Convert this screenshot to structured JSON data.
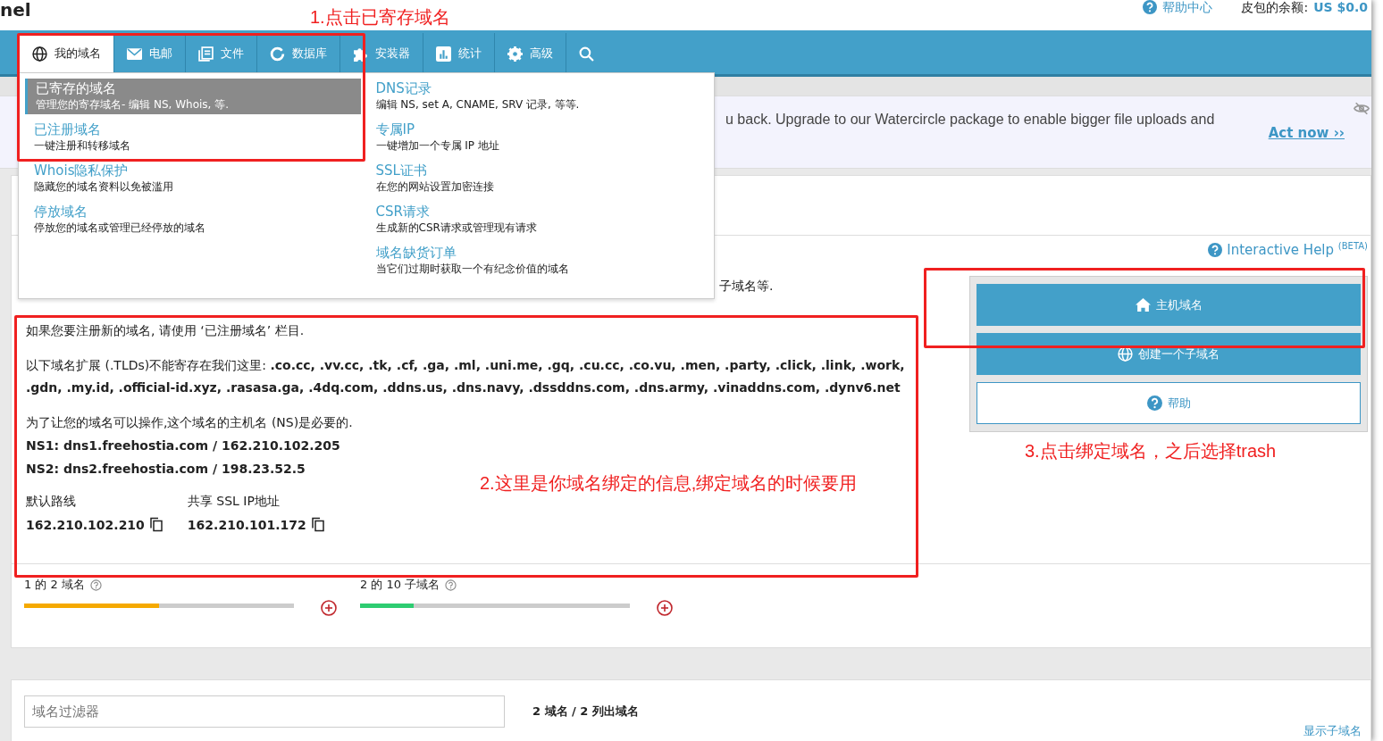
{
  "header": {
    "logo": "nel",
    "help_link": "帮助中心",
    "balance_label": "皮包的余额:",
    "balance_value": "US $0.0"
  },
  "nav": {
    "tabs": [
      {
        "label": "我的域名",
        "selected": true
      },
      {
        "label": "电邮",
        "selected": false
      },
      {
        "label": "文件",
        "selected": false
      },
      {
        "label": "数据库",
        "selected": false
      },
      {
        "label": "安装器",
        "selected": false
      },
      {
        "label": "统计",
        "selected": false
      },
      {
        "label": "高级",
        "selected": false
      }
    ]
  },
  "menu": {
    "columns": [
      [
        {
          "title": "已寄存的域名",
          "description": "管理您的寄存域名- 编辑 NS, Whois, 等.",
          "selected": true
        },
        {
          "title": "已注册域名",
          "description": "一键注册和转移域名",
          "selected": false
        },
        {
          "title": "Whois隐私保护",
          "description": "隐藏您的域名资料以免被滥用",
          "selected": false
        },
        {
          "title": "停放域名",
          "description": "停放您的域名或管理已经停放的域名",
          "selected": false
        }
      ],
      [
        {
          "title": "DNS记录",
          "description": "编辑 NS, set A, CNAME, SRV 记录, 等等.",
          "selected": false
        },
        {
          "title": "专属IP",
          "description": "一键增加一个专属 IP 地址",
          "selected": false
        },
        {
          "title": "SSL证书",
          "description": "在您的网站设置加密连接",
          "selected": false
        },
        {
          "title": "CSR请求",
          "description": "生成新的CSR请求或管理现有请求",
          "selected": false
        },
        {
          "title": "域名缺货订单",
          "description": "当它们过期时获取一个有纪念价值的域名",
          "selected": false
        }
      ]
    ]
  },
  "banner": {
    "text": "u back. Upgrade to our Watercircle package to enable bigger file uploads and",
    "link": "Act now ››"
  },
  "intro_tail": "子域名等.",
  "interactive_help": "Interactive Help $^{(BETA)}$",
  "side_buttons": [
    {
      "label": "主机域名",
      "kind": "primary"
    },
    {
      "label": "创建一个子域名",
      "kind": "primary"
    },
    {
      "label": "帮助",
      "kind": "outline"
    }
  ],
  "info": {
    "note": "如果您要注册新的域名, 请使用 ‘已注册域名’ 栏目.",
    "tlds": "以下域名扩展 (.TLDs)不能寄存在我们这里: **.co.cc, .vv.cc, .tk, .cf, .ga, .ml, .uni.me, .gq, .cu.cc, .co.vu, .men, .party, .click, .link, .work, .gdn, .my.id, .official-id.xyz, .rasasa.ga, .4dq.com, .ddns.us, .dns.navy, .dssddns.com, .dns.army, .vinaddns.com, .dynv6.net**",
    "ns_note": "为了让您的域名可以操作,这个域名的主机名 (NS)是必要的.",
    "ns": [
      "NS1: dns1.freehostia.com / 162.210.102.205",
      "NS2: dns2.freehostia.com / 198.23.52.5"
    ],
    "addresses": [
      {
        "label": "默认路线",
        "value": "162.210.102.210"
      },
      {
        "label": "共享 SSL IP地址",
        "value": "162.210.101.172"
      }
    ]
  },
  "usage": [
    {
      "label": "1 的 2 域名",
      "level": 0.5,
      "color": "#f5a900"
    },
    {
      "label": "2 的 10 子域名",
      "level": 0.2,
      "color": "#2ecc71"
    }
  ],
  "filter": {
    "placeholder": "域名过滤器"
  },
  "count": "2 域名 / 2 列出域名",
  "show_subdomains": "显示子域名",
  "annotations": [
    {
      "text": "1.点击已寄存域名"
    },
    {
      "text": "2.这里是你域名绑定的信息,绑定域名的时候要用"
    },
    {
      "text": "3.点击绑定域名，之后选择trash"
    }
  ]
}
